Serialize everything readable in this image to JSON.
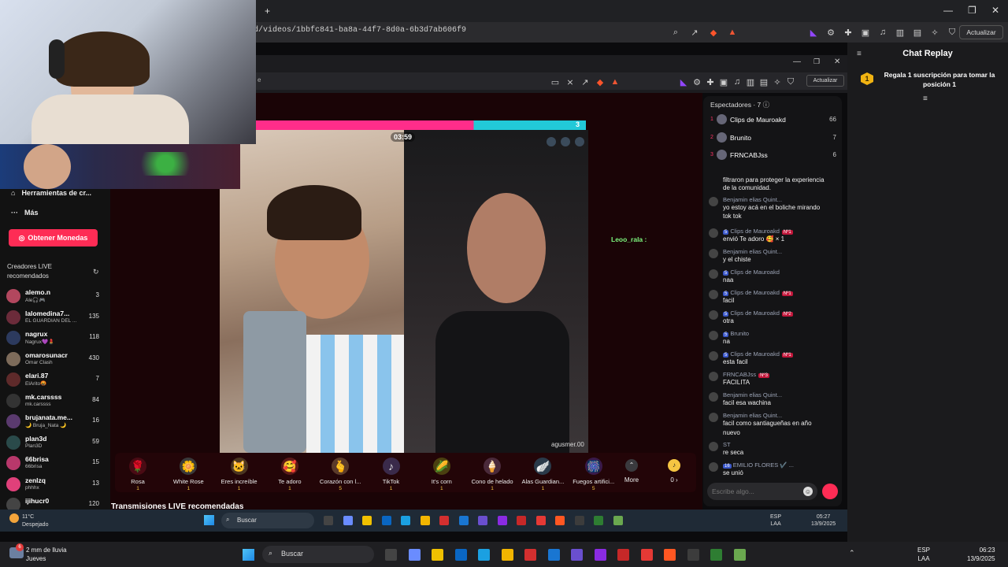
{
  "outer_browser": {
    "url": "/d/videos/1bbfc841-ba8a-44f7-8d0a-6b3d7ab606f9",
    "new_tab": "+",
    "update_label": "Actualizar"
  },
  "chat_replay": {
    "title": "Chat Replay",
    "badge": "1",
    "message": "Regala 1 suscripción para tomar la posición 1"
  },
  "inner_browser": {
    "update_label": "Actualizar",
    "url_stub": "e"
  },
  "sidebar": {
    "tools_label": "Herramientas de cr...",
    "more_label": "Más",
    "coins_button": "Obtener Monedas",
    "creators_title": "Creadores LIVE recomendados",
    "creators": [
      {
        "name": "alemo.n",
        "sub": "Ale🎧🎮",
        "count": "3",
        "color": "#b2475e"
      },
      {
        "name": "lalomedina7...",
        "sub": "EL GUARDIAN DEL ...",
        "count": "135",
        "color": "#6b2b3a"
      },
      {
        "name": "nagrux",
        "sub": "Nagrux💜💄",
        "count": "118",
        "color": "#2c3a5e"
      },
      {
        "name": "omarosunacr",
        "sub": "Omar Clash",
        "count": "430",
        "color": "#7d6b5a"
      },
      {
        "name": "elari.87",
        "sub": "ElArito🤬",
        "count": "7",
        "color": "#5e2a2a"
      },
      {
        "name": "mk.carssss",
        "sub": "mk.carssss",
        "count": "84",
        "color": "#333"
      },
      {
        "name": "brujanata.me...",
        "sub": "🌙 Bruja_Nata 🌙",
        "count": "16",
        "color": "#5a3a6e"
      },
      {
        "name": "plan3d",
        "sub": "Plan3D",
        "count": "59",
        "color": "#2a4a4a"
      },
      {
        "name": "66brisa",
        "sub": "66brisa",
        "count": "15",
        "color": "#b8386b"
      },
      {
        "name": "zenlzq",
        "sub": "phhhx",
        "count": "13",
        "color": "#e0407a"
      },
      {
        "name": "ijihucr0",
        "sub": "",
        "count": "120",
        "color": "#444"
      }
    ]
  },
  "stream": {
    "score_right": "3",
    "timer": "03:59",
    "right_username": "agusmer.00",
    "side_comment_user": "Leoo_rala :",
    "rec_title": "Transmisiones LIVE recomendadas"
  },
  "gifts": [
    {
      "name": "Rosa",
      "price": "1",
      "glyph": "🌹",
      "color": "#4a0b14"
    },
    {
      "name": "White Rose",
      "price": "1",
      "glyph": "🌼",
      "color": "#3a3a3a"
    },
    {
      "name": "Eres increíble",
      "price": "1",
      "glyph": "🐱",
      "color": "#4a3520"
    },
    {
      "name": "Te adoro",
      "price": "1",
      "glyph": "🥰",
      "color": "#5a1a1a"
    },
    {
      "name": "Corazón con l...",
      "price": "5",
      "glyph": "🫰",
      "color": "#5a3a2a"
    },
    {
      "name": "TikTok",
      "price": "1",
      "glyph": "♪",
      "color": "#3a2a4a"
    },
    {
      "name": "It's corn",
      "price": "1",
      "glyph": "🌽",
      "color": "#4a4010"
    },
    {
      "name": "Cono de helado",
      "price": "1",
      "glyph": "🍦",
      "color": "#4a2a3a"
    },
    {
      "name": "Alas Guardian...",
      "price": "1",
      "glyph": "🪽",
      "color": "#2a3a4a"
    },
    {
      "name": "Fuegos artifici...",
      "price": "5",
      "glyph": "🎆",
      "color": "#3a1a4a"
    }
  ],
  "gift_more": "More",
  "coin_balance": "0 ›",
  "chat": {
    "viewers_title": "Espectadores · 7",
    "viewers": [
      {
        "rank": "1",
        "name": "Clips de Mauroakd",
        "score": "66"
      },
      {
        "rank": "2",
        "name": "Brunito",
        "score": "7"
      },
      {
        "rank": "3",
        "name": "FRNCABJss",
        "score": "6"
      }
    ],
    "messages": [
      {
        "user": "",
        "text": "filtraron para proteger la experiencia",
        "lvl": "",
        "fan": ""
      },
      {
        "user": "",
        "text": "de la comunidad.",
        "lvl": "",
        "fan": ""
      },
      {
        "user": "Benjamin elias Quint...",
        "text": "yo estoy acá en el boliche mirando",
        "lvl": "",
        "fan": ""
      },
      {
        "user": "",
        "text": "tok tok",
        "lvl": "",
        "fan": ""
      },
      {
        "user": "Clips de Mauroakd",
        "text": "envió Te adoro 🥰 × 1",
        "lvl": "5",
        "fan": "Nº1"
      },
      {
        "user": "Benjamin elias Quint...",
        "text": "y el chiste",
        "lvl": "",
        "fan": ""
      },
      {
        "user": "Clips de Mauroakd",
        "text": "naa",
        "lvl": "5",
        "fan": ""
      },
      {
        "user": "Clips de Mauroakd",
        "text": "facil",
        "lvl": "5",
        "fan": "Nº1"
      },
      {
        "user": "Clips de Mauroakd",
        "text": "otra",
        "lvl": "5",
        "fan": "Nº2"
      },
      {
        "user": "Brunito",
        "text": "na",
        "lvl": "5",
        "fan": ""
      },
      {
        "user": "Clips de Mauroakd",
        "text": "esta facil",
        "lvl": "5",
        "fan": "Nº1"
      },
      {
        "user": "FRNCABJss",
        "text": "FACILITA",
        "lvl": "",
        "fan": "Nº3"
      },
      {
        "user": "Benjamin elias Quint...",
        "text": "facil esa wachina",
        "lvl": "",
        "fan": ""
      },
      {
        "user": "Benjamin elias Quint...",
        "text": "facil como santiagueñas en año",
        "lvl": "",
        "fan": ""
      },
      {
        "user": "",
        "text": "nuevo",
        "lvl": "",
        "fan": ""
      },
      {
        "user": "ST",
        "text": "re seca",
        "lvl": "",
        "fan": ""
      },
      {
        "user": "EMILIO FLORES ✔️ ...",
        "text": "se unió",
        "lvl": "16",
        "fan": ""
      }
    ],
    "input_placeholder": "Escribe algo..."
  },
  "inner_taskbar": {
    "weather_temp": "11°C",
    "weather_desc": "Despejado",
    "search": "Buscar",
    "lang": "ESP",
    "lang2": "LAA",
    "time": "05:27",
    "date": "13/9/2025"
  },
  "taskbar": {
    "weather_temp": "2 mm de lluvia",
    "weather_desc": "Jueves",
    "badge": "6",
    "search": "Buscar",
    "lang": "ESP",
    "lang2": "LAA",
    "time": "06:23",
    "date": "13/9/2025"
  }
}
